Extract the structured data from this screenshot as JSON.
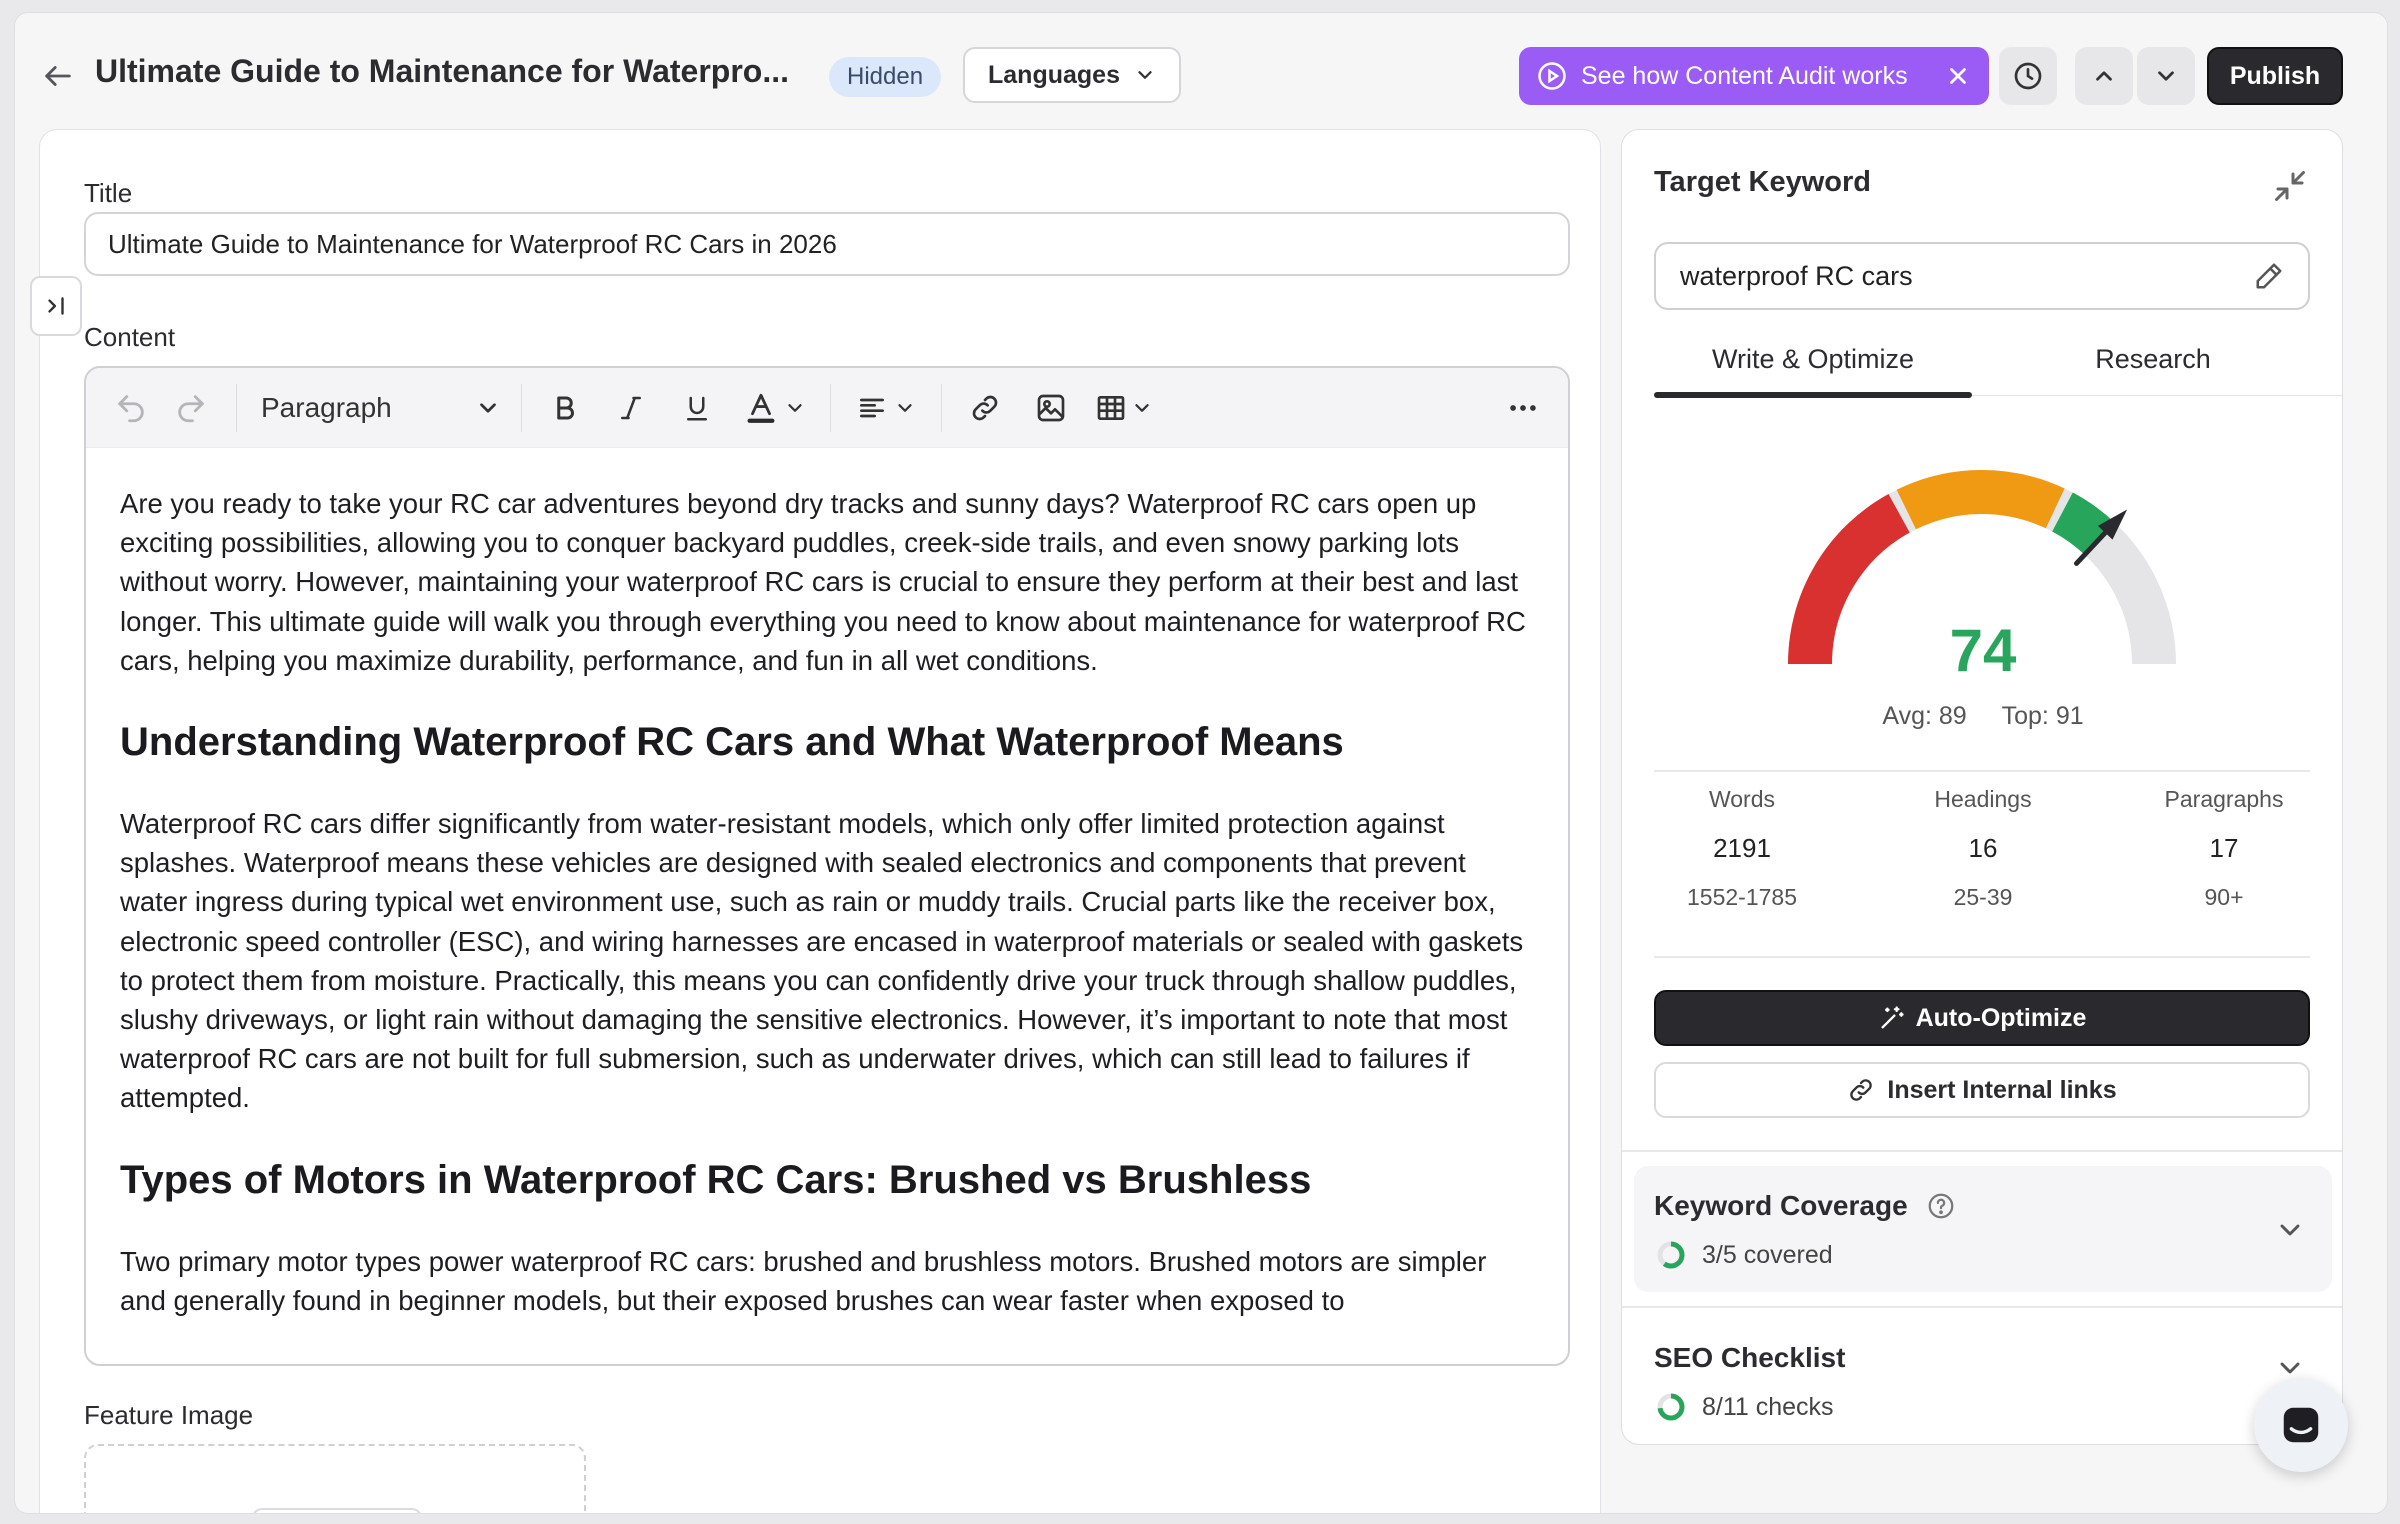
{
  "header": {
    "doc_title": "Ultimate Guide to Maintenance for Waterpro...",
    "status_badge": "Hidden",
    "languages_label": "Languages",
    "audit_label": "See how Content Audit works",
    "publish_label": "Publish"
  },
  "editor": {
    "title_label": "Title",
    "title_value": "Ultimate Guide to Maintenance for Waterproof RC Cars in 2026",
    "content_label": "Content",
    "block_type": "Paragraph",
    "feature_image_label": "Feature Image",
    "body": {
      "p1": "Are you ready to take your RC car adventures beyond dry tracks and sunny days? Waterproof RC cars open up exciting possibilities, allowing you to conquer backyard puddles, creek-side trails, and even snowy parking lots without worry. However, maintaining your waterproof RC cars is crucial to ensure they perform at their best and last longer. This ultimate guide will walk you through everything you need to know about maintenance for waterproof RC cars, helping you maximize durability, performance, and fun in all wet conditions.",
      "h1": "Understanding Waterproof RC Cars and What Waterproof Means",
      "p2": "Waterproof RC cars differ significantly from water-resistant models, which only offer limited protection against splashes. Waterproof means these vehicles are designed with sealed electronics and components that prevent water ingress during typical wet environment use, such as rain or muddy trails. Crucial parts like the receiver box, electronic speed controller (ESC), and wiring harnesses are encased in waterproof materials or sealed with gaskets to protect them from moisture. Practically, this means you can confidently drive your truck through shallow puddles, slushy driveways, or light rain without damaging the sensitive electronics. However, it’s important to note that most waterproof RC cars are not built for full submersion, such as underwater drives, which can still lead to failures if attempted.",
      "h2": "Types of Motors in Waterproof RC Cars: Brushed vs Brushless",
      "p3": "Two primary motor types power waterproof RC cars: brushed and brushless motors. Brushed motors are simpler and generally found in beginner models, but their exposed brushes can wear faster when exposed to"
    }
  },
  "panel": {
    "title": "Target Keyword",
    "keyword": "waterproof RC cars",
    "tabs": [
      "Write & Optimize",
      "Research"
    ],
    "score": {
      "value": "74",
      "score_number": 74,
      "max": 100,
      "avg_label": "Avg: 89",
      "top_label": "Top: 91",
      "colors": {
        "low": "#d8312f",
        "mid": "#f09a14",
        "high": "#27a55a",
        "track": "#e5e5e7"
      }
    },
    "stats": [
      {
        "label": "Words",
        "value": "2191",
        "range": "1552-1785"
      },
      {
        "label": "Headings",
        "value": "16",
        "range": "25-39"
      },
      {
        "label": "Paragraphs",
        "value": "17",
        "range": "90+"
      }
    ],
    "auto_optimize_label": "Auto-Optimize",
    "internal_links_label": "Insert Internal links",
    "keyword_coverage": {
      "title": "Keyword Coverage",
      "summary": "3/5 covered",
      "fraction": 0.6
    },
    "seo_checklist": {
      "title": "SEO Checklist",
      "summary": "8/11 checks",
      "fraction": 0.727
    }
  }
}
